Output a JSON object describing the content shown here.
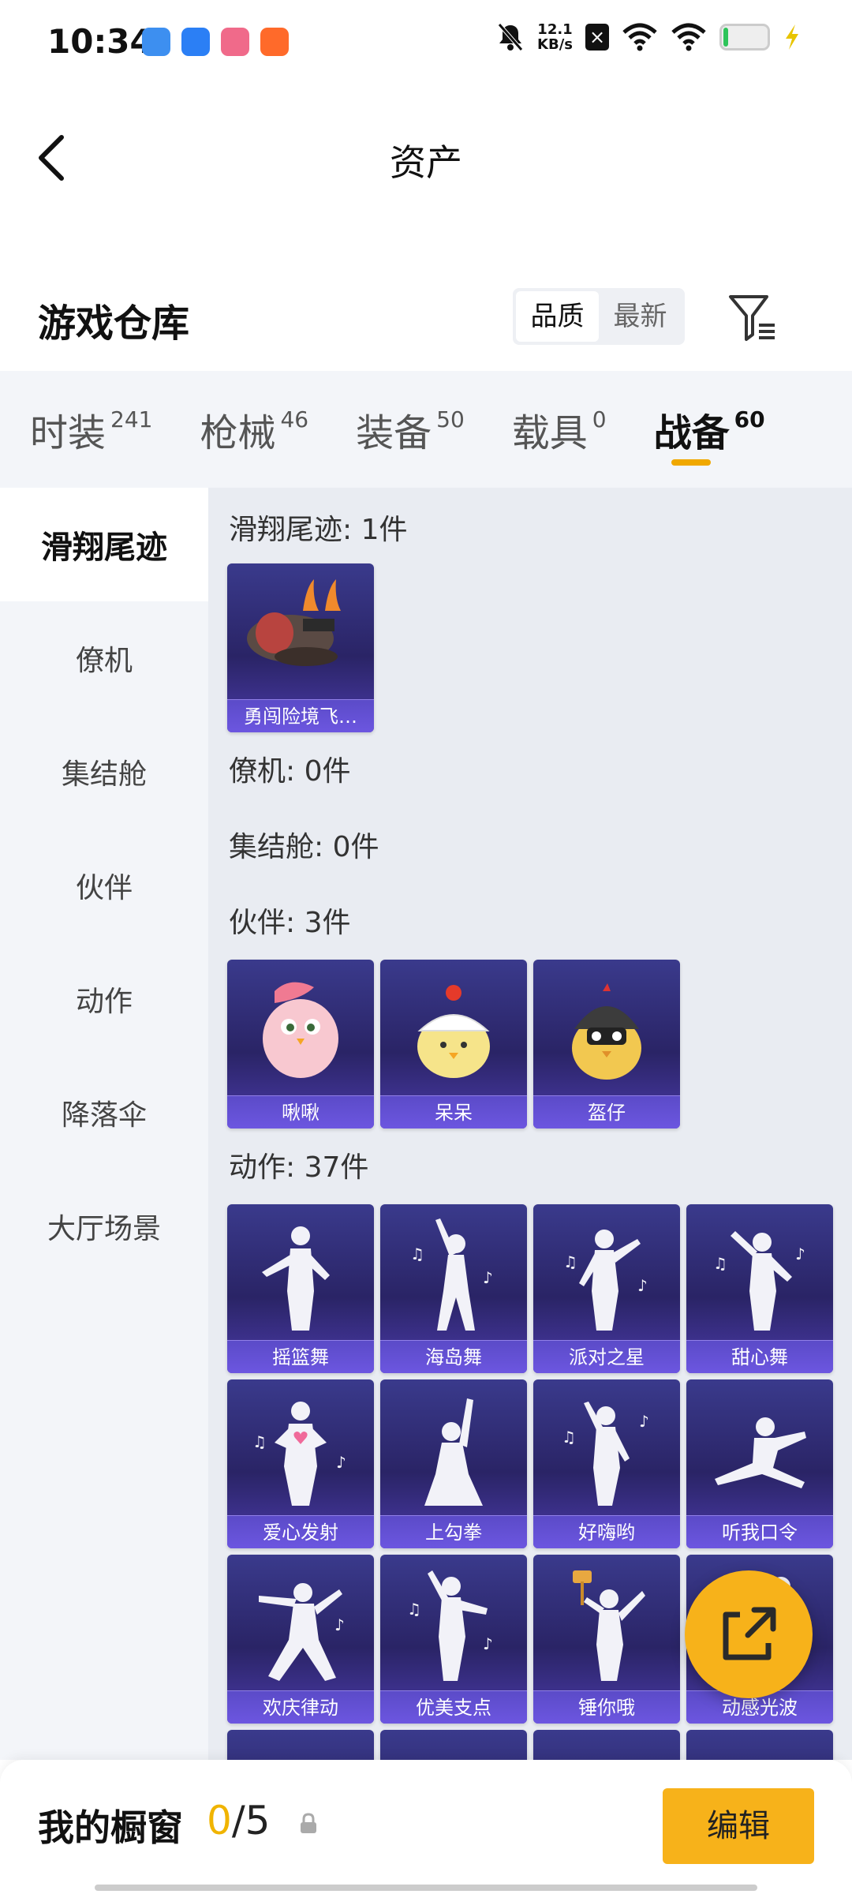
{
  "status_bar": {
    "time": "10:34",
    "net_speed": "12.1",
    "net_unit": "KB/s",
    "x_badge": "×",
    "battery_level": 0.1
  },
  "header": {
    "title": "资产"
  },
  "warehouse": {
    "title": "游戏仓库",
    "sort_options": [
      "品质",
      "最新"
    ],
    "active_sort": "品质"
  },
  "tabs": [
    {
      "label": "时装",
      "count": "241"
    },
    {
      "label": "枪械",
      "count": "46"
    },
    {
      "label": "装备",
      "count": "50"
    },
    {
      "label": "载具",
      "count": "0"
    },
    {
      "label": "战备",
      "count": "60",
      "active": true
    }
  ],
  "side_menu": [
    {
      "label": "滑翔尾迹",
      "active": true
    },
    {
      "label": "僚机"
    },
    {
      "label": "集结舱"
    },
    {
      "label": "伙伴"
    },
    {
      "label": "动作"
    },
    {
      "label": "降落伞"
    },
    {
      "label": "大厅场景"
    }
  ],
  "sections": {
    "glide": {
      "title": "滑翔尾迹: 1件",
      "items": [
        "勇闯险境飞…"
      ]
    },
    "wingman": {
      "title": "僚机: 0件"
    },
    "pod": {
      "title": "集结舱: 0件"
    },
    "partner": {
      "title": "伙伴: 3件",
      "items": [
        "啾啾",
        "呆呆",
        "盔仔"
      ]
    },
    "emote": {
      "title": "动作: 37件",
      "items": [
        "摇篮舞",
        "海岛舞",
        "派对之星",
        "甜心舞",
        "爱心发射",
        "上勾拳",
        "好嗨哟",
        "听我口令",
        "欢庆律动",
        "优美支点",
        "锤你哦",
        "动感光波"
      ]
    }
  },
  "bottom_bar": {
    "label": "我的橱窗",
    "current": "0",
    "total": "/5",
    "edit_label": "编辑"
  },
  "icons": {
    "back": "back-arrow-icon",
    "filter": "filter-icon",
    "share": "share-external-icon",
    "lock": "lock-icon"
  },
  "colors": {
    "accent": "#f7b21a",
    "card_bg": "#2a2466",
    "card_label": "#6c56e0"
  }
}
